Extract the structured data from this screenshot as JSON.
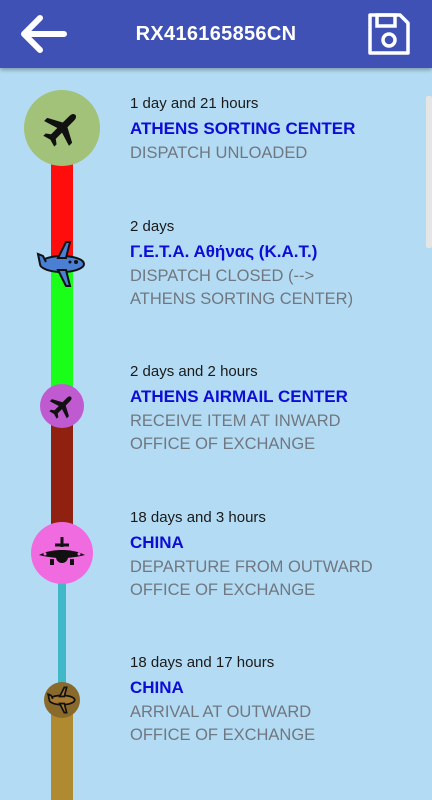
{
  "app_bar": {
    "title": "RX416165856CN",
    "back_icon": "back-arrow-icon",
    "save_icon": "floppy-disk-save-icon",
    "background_color": "#3f51b5"
  },
  "timeline": {
    "segment_colors": [
      "#ff0d0d",
      "#1aff1a",
      "#902010",
      "#40b8c8",
      "#b08a30"
    ],
    "events": [
      {
        "time": "1 day and 21 hours",
        "location": "ATHENS SORTING CENTER",
        "status": [
          "DISPATCH UNLOADED"
        ],
        "icon": "airplane-icon",
        "icon_color": "#a2c27a"
      },
      {
        "time": "2 days",
        "location": "Γ.Ε.Τ.Α. Αθήνας (Κ.Α.Τ.)",
        "status": [
          "DISPATCH CLOSED (-->",
          "ATHENS SORTING CENTER)"
        ],
        "icon": "airplane-side-icon",
        "icon_color": "#4a7fd4"
      },
      {
        "time": "2 days and 2 hours",
        "location": "ATHENS AIRMAIL CENTER",
        "status": [
          "RECEIVE ITEM AT INWARD",
          "OFFICE OF EXCHANGE"
        ],
        "icon": "airplane-icon",
        "icon_color": "#c05ad0"
      },
      {
        "time": "18 days and 3 hours",
        "location": "CHINA",
        "status": [
          "DEPARTURE FROM OUTWARD",
          "OFFICE OF EXCHANGE"
        ],
        "icon": "airplane-front-icon",
        "icon_color": "#f06ae0"
      },
      {
        "time": "18 days and 17 hours",
        "location": "CHINA",
        "status": [
          "ARRIVAL AT OUTWARD",
          "OFFICE OF EXCHANGE"
        ],
        "icon": "airplane-side-icon",
        "icon_color": "#8a6a2a"
      }
    ]
  }
}
